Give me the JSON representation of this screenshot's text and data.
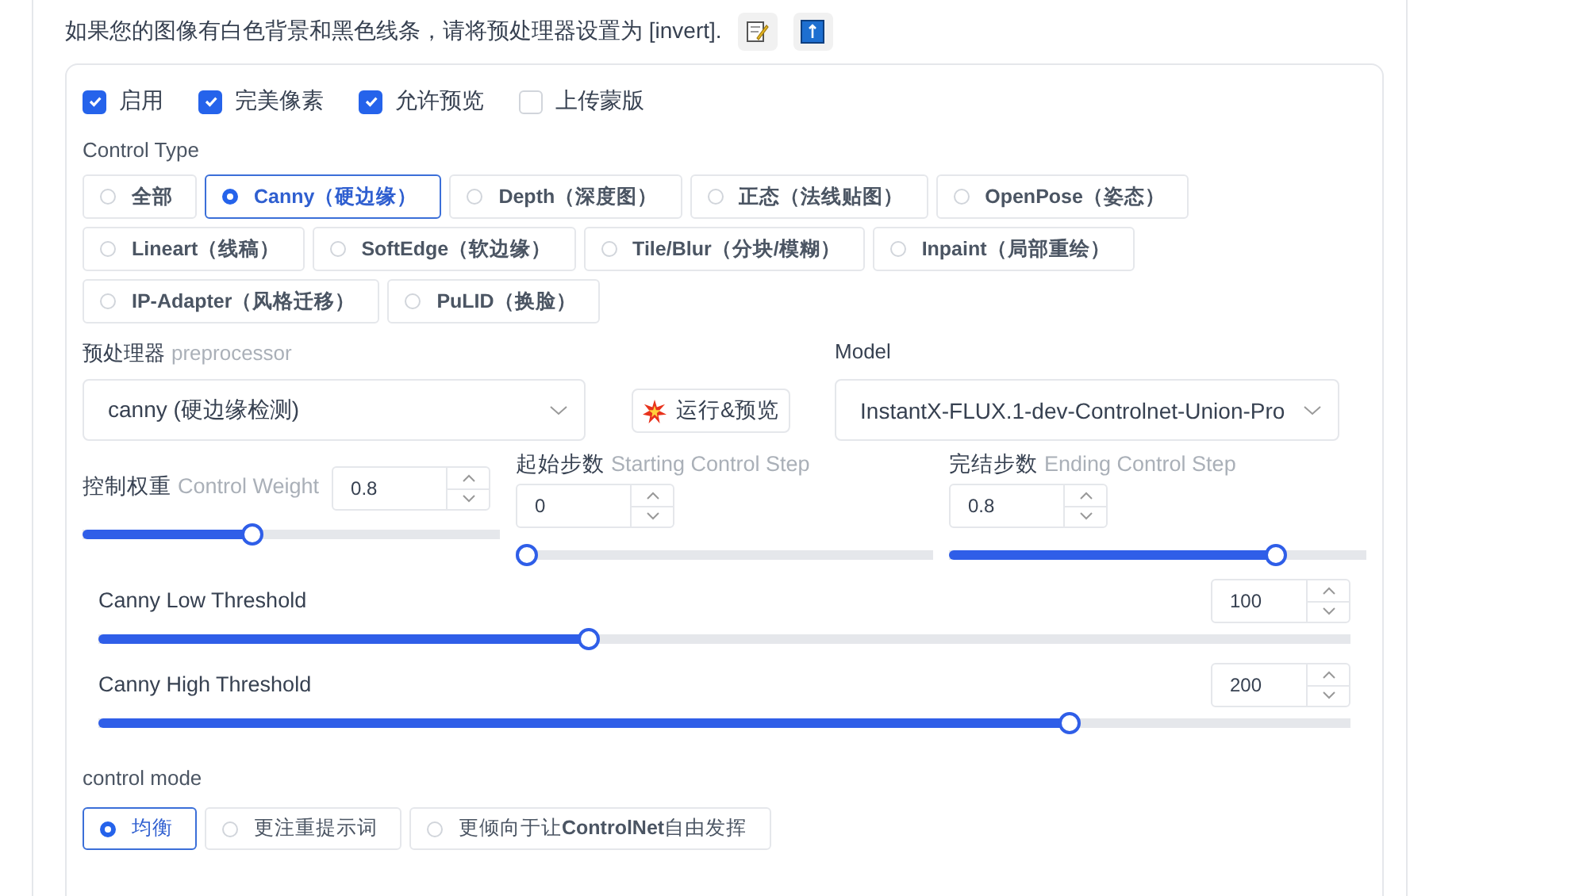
{
  "hint": {
    "text": "如果您的图像有白色背景和黑色线条，请将预处理器设置为 [invert].",
    "buttons": [
      {
        "kind": "memo"
      },
      {
        "kind": "upload"
      }
    ]
  },
  "checkboxes": [
    {
      "label": "启用",
      "checked": true
    },
    {
      "label": "完美像素",
      "checked": true
    },
    {
      "label": "允许预览",
      "checked": true
    },
    {
      "label": "上传蒙版",
      "checked": false
    }
  ],
  "control_type": {
    "label": "Control Type",
    "options": [
      {
        "label": "全部",
        "selected": false
      },
      {
        "label": "Canny（硬边缘）",
        "selected": true
      },
      {
        "label": "Depth（深度图）",
        "selected": false
      },
      {
        "label": "正态（法线贴图）",
        "selected": false
      },
      {
        "label": "OpenPose（姿态）",
        "selected": false
      },
      {
        "label": "Lineart（线稿）",
        "selected": false
      },
      {
        "label": "SoftEdge（软边缘）",
        "selected": false
      },
      {
        "label": "Tile/Blur（分块/模糊）",
        "selected": false
      },
      {
        "label": "Inpaint（局部重绘）",
        "selected": false
      },
      {
        "label": "IP-Adapter（风格迁移）",
        "selected": false
      },
      {
        "label": "PuLID（换脸）",
        "selected": false
      }
    ]
  },
  "preprocessor": {
    "label": "预处理器",
    "sublabel": "preprocessor",
    "value": "canny (硬边缘检测)"
  },
  "run_button": {
    "label": "运行&预览"
  },
  "model": {
    "label": "Model",
    "value": "InstantX-FLUX.1-dev-Controlnet-Union-Pro"
  },
  "steps": [
    {
      "kind": "inline",
      "label": "控制权重",
      "sublabel": "Control Weight",
      "value": "0.8",
      "level": 0.4
    },
    {
      "kind": "stacked",
      "label": "起始步数",
      "sublabel": "Starting Control Step",
      "value": "0",
      "level": 0
    },
    {
      "kind": "stacked",
      "label": "完结步数",
      "sublabel": "Ending Control Step",
      "value": "0.8",
      "level": 0.8
    }
  ],
  "thresholds": [
    {
      "label": "Canny Low Threshold",
      "value": "100",
      "level": 0.39
    },
    {
      "label": "Canny High Threshold",
      "value": "200",
      "level": 0.78
    }
  ],
  "control_mode": {
    "label": "control mode",
    "options": [
      {
        "label": "均衡",
        "selected": true
      },
      {
        "label": "更注重提示词",
        "selected": false
      },
      {
        "label": "更倾向于让**ControlNet**自由发挥",
        "selected": false
      }
    ]
  }
}
